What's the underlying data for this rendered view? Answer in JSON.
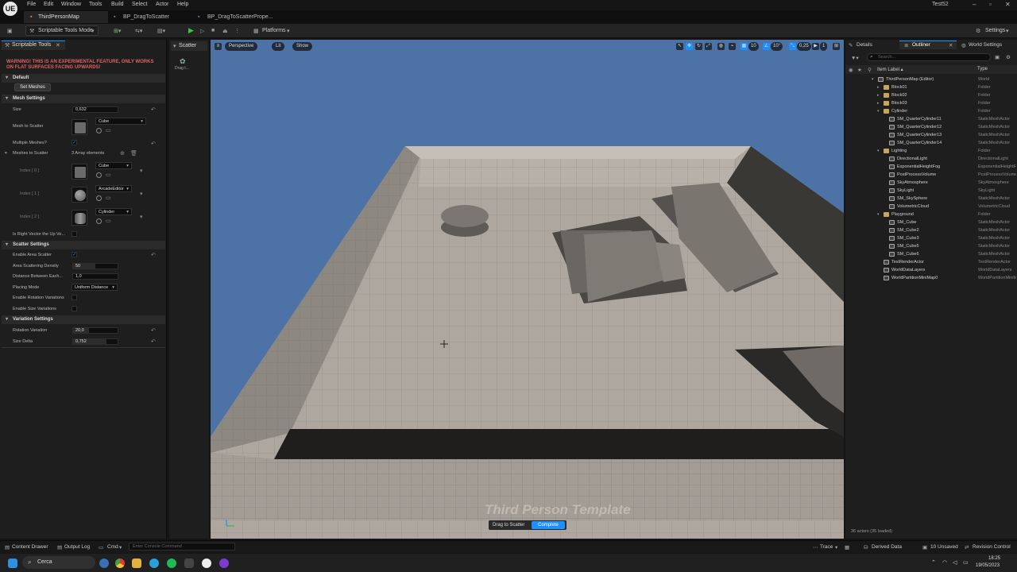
{
  "menubar": {
    "logo": "UE",
    "items": [
      "File",
      "Edit",
      "Window",
      "Tools",
      "Build",
      "Select",
      "Actor",
      "Help"
    ],
    "project": "Test52"
  },
  "tabs": [
    "ThirdPersonMap",
    "BP_DragToScatter",
    "BP_DragToScatterPrope..."
  ],
  "toolbar": {
    "mode": "Scriptable Tools Mode",
    "platforms": "Platforms",
    "settings": "Settings"
  },
  "left_panel": {
    "tab": "Scriptable Tools",
    "warning": "WARNING! THIS IS AN EXPERIMENTAL FEATURE, ONLY WORKS ON FLAT SURFACES FACING UPWARDS!",
    "default_section": "Default",
    "set_meshes_button": "Set Meshes",
    "mesh_settings": {
      "title": "Mesh Settings",
      "size_label": "Size",
      "size_value": "0,632",
      "mesh_to_scatter_label": "Mesh to Scatter",
      "mesh_to_scatter_value": "Cube",
      "multiple_meshes_label": "Multiple Meshes?",
      "meshes_to_scatter_label": "Meshes to Scatter",
      "meshes_count": "3 Array elements",
      "items": [
        {
          "index": "Index [ 0 ]",
          "value": "Cube"
        },
        {
          "index": "Index [ 1 ]",
          "value": "ArcadeEditor"
        },
        {
          "index": "Index [ 2 ]",
          "value": "Cylinder"
        }
      ],
      "right_vector_label": "Is Right Vector the Up Ve..."
    },
    "scatter_settings": {
      "title": "Scatter Settings",
      "enable_area_label": "Enable Area Scatter",
      "density_label": "Area Scattering Density",
      "density_value": "50",
      "distance_label": "Distance Between Each...",
      "distance_value": "1,0",
      "placing_label": "Placing Mode",
      "placing_value": "Uniform Distance",
      "rotation_var_label": "Enable Rotation Variations",
      "size_var_label": "Enable Size Variations"
    },
    "variation_settings": {
      "title": "Variation Settings",
      "rotation_label": "Rotation Variation",
      "rotation_value": "20,0",
      "rotation_fraction": 0.35,
      "size_delta_label": "Size Delta",
      "size_delta_value": "0,752",
      "size_delta_fraction": 0.75
    }
  },
  "scatter_panel": {
    "tab": "Scatter",
    "tool_label": "Drag t..."
  },
  "viewport": {
    "perspective": "Perspective",
    "lit": "Lit",
    "show": "Show",
    "grid_snap": "10",
    "rot_snap": "10°",
    "scale_snap": "0,25",
    "camera_speed": "1",
    "watermark": "Third Person Template",
    "axis_label": "Y",
    "notify_text": "Drag to Scatter",
    "notify_button": "Complete"
  },
  "right_panel": {
    "tabs": [
      "Details",
      "Outliner",
      "World Settings"
    ],
    "search_placeholder": "Search...",
    "col_label": "Item Label ▴",
    "col_type": "Type",
    "rows": [
      {
        "name": "ThirdPersonMap (Editor)",
        "type": "World"
      },
      {
        "name": "Block01",
        "type": "Folder"
      },
      {
        "name": "Block02",
        "type": "Folder"
      },
      {
        "name": "Block03",
        "type": "Folder"
      },
      {
        "name": "Cylinder",
        "type": "Folder"
      },
      {
        "name": "SM_QuarterCylinder11",
        "type": "StaticMeshActor"
      },
      {
        "name": "SM_QuarterCylinder12",
        "type": "StaticMeshActor"
      },
      {
        "name": "SM_QuarterCylinder13",
        "type": "StaticMeshActor"
      },
      {
        "name": "SM_QuarterCylinder14",
        "type": "StaticMeshActor"
      },
      {
        "name": "Lighting",
        "type": "Folder"
      },
      {
        "name": "DirectionalLight",
        "type": "DirectionalLight"
      },
      {
        "name": "ExponentialHeightFog",
        "type": "ExponentialHeightFog"
      },
      {
        "name": "PostProcessVolume",
        "type": "PostProcessVolume"
      },
      {
        "name": "SkyAtmosphere",
        "type": "SkyAtmosphere"
      },
      {
        "name": "SkyLight",
        "type": "SkyLight"
      },
      {
        "name": "SM_SkySphere",
        "type": "StaticMeshActor"
      },
      {
        "name": "VolumetricCloud",
        "type": "VolumetricCloud"
      },
      {
        "name": "Playground",
        "type": "Folder"
      },
      {
        "name": "SM_Cube",
        "type": "StaticMeshActor"
      },
      {
        "name": "SM_Cube2",
        "type": "StaticMeshActor"
      },
      {
        "name": "SM_Cube3",
        "type": "StaticMeshActor"
      },
      {
        "name": "SM_Cube5",
        "type": "StaticMeshActor"
      },
      {
        "name": "SM_Cube6",
        "type": "StaticMeshActor"
      },
      {
        "name": "TextRenderActor",
        "type": "TextRenderActor"
      },
      {
        "name": "WorldDataLayers",
        "type": "WorldDataLayers"
      },
      {
        "name": "WorldPartitionMiniMap0",
        "type": "WorldPartitionMiniMap"
      }
    ],
    "actor_count": "36 actors (35 loaded)"
  },
  "statusbar": {
    "content_drawer": "Content Drawer",
    "output_log": "Output Log",
    "cmd": "Cmd",
    "console_placeholder": "Enter Console Command",
    "trace": "Trace",
    "derived_data": "Derived Data",
    "unsaved": "10 Unsaved",
    "revision": "Revision Control"
  },
  "taskbar": {
    "search": "Cerca",
    "time": "18:25",
    "date": "19/05/2023"
  },
  "colors": {
    "accent": "#1e8fff",
    "warning": "#e06060",
    "sky": "#4a6fa0",
    "play": "#3cc43c"
  }
}
